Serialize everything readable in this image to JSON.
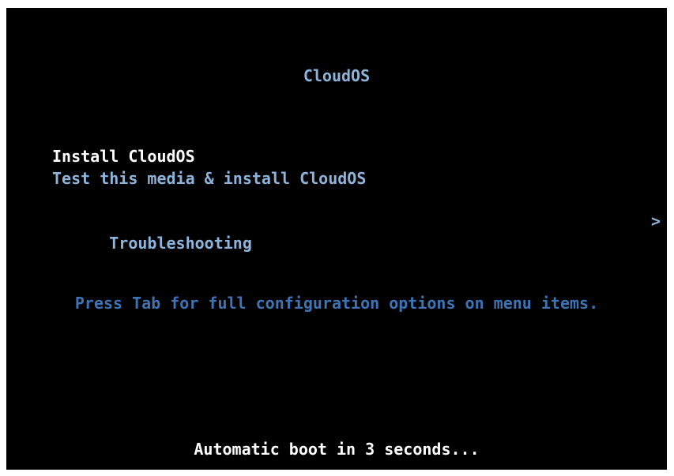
{
  "title": "CloudOS",
  "menu": {
    "items": [
      {
        "label": "Install CloudOS",
        "selected": true
      },
      {
        "label": "Test this media & install CloudOS",
        "selected": false
      }
    ],
    "submenu": {
      "label": "Troubleshooting",
      "chevron": ">",
      "icon": "chevron-right-icon"
    }
  },
  "hint": "Press Tab for full configuration options on menu items.",
  "boot_message": "Automatic boot in 3 seconds...",
  "colors": {
    "background": "#000000",
    "selected_text": "#ffffff",
    "menu_text": "#8fb4dc",
    "hint_text": "#3f73b4"
  }
}
